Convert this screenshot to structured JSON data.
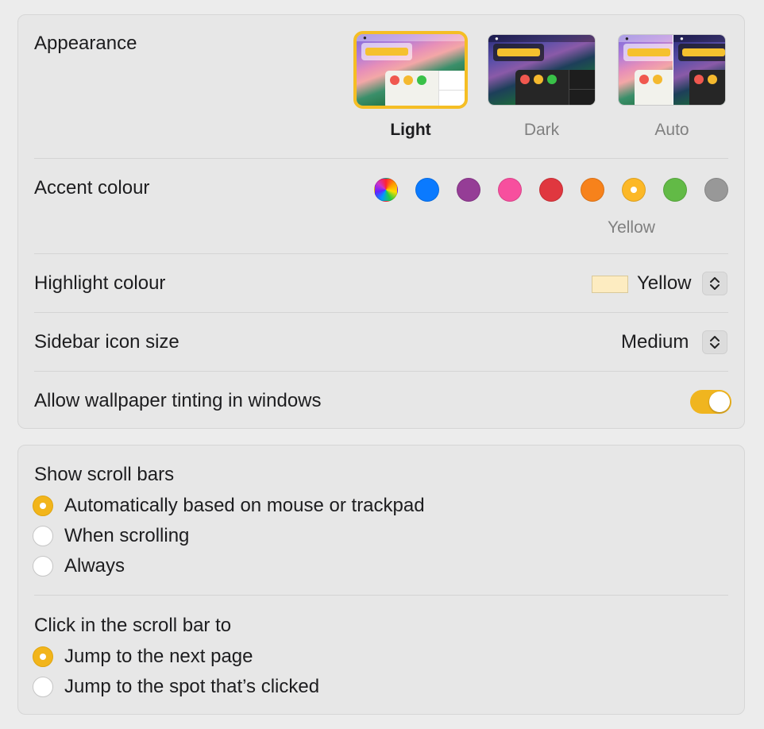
{
  "appearance": {
    "label": "Appearance",
    "options": [
      {
        "label": "Light",
        "selected": true
      },
      {
        "label": "Dark",
        "selected": false
      },
      {
        "label": "Auto",
        "selected": false
      }
    ]
  },
  "accent": {
    "label": "Accent colour",
    "colors": [
      {
        "name": "multicolour",
        "hex": "multicolor"
      },
      {
        "name": "blue",
        "hex": "#0a7aff"
      },
      {
        "name": "purple",
        "hex": "#953d96"
      },
      {
        "name": "pink",
        "hex": "#f74f9e"
      },
      {
        "name": "red",
        "hex": "#e0373f"
      },
      {
        "name": "orange",
        "hex": "#f7821b"
      },
      {
        "name": "yellow",
        "hex": "#fcb827"
      },
      {
        "name": "green",
        "hex": "#62ba46"
      },
      {
        "name": "graphite",
        "hex": "#989898"
      }
    ],
    "selected_index": 6,
    "selected_caption": "Yellow"
  },
  "highlight": {
    "label": "Highlight colour",
    "swatch_color": "#fdecc1",
    "value": "Yellow"
  },
  "sidebar_icon_size": {
    "label": "Sidebar icon size",
    "value": "Medium"
  },
  "wallpaper_tinting": {
    "label": "Allow wallpaper tinting in windows",
    "on": true
  },
  "scroll_bars": {
    "title": "Show scroll bars",
    "options": [
      {
        "label": "Automatically based on mouse or trackpad",
        "selected": true
      },
      {
        "label": "When scrolling",
        "selected": false
      },
      {
        "label": "Always",
        "selected": false
      }
    ]
  },
  "click_scroll": {
    "title": "Click in the scroll bar to",
    "options": [
      {
        "label": "Jump to the next page",
        "selected": true
      },
      {
        "label": "Jump to the spot that’s clicked",
        "selected": false
      }
    ]
  }
}
